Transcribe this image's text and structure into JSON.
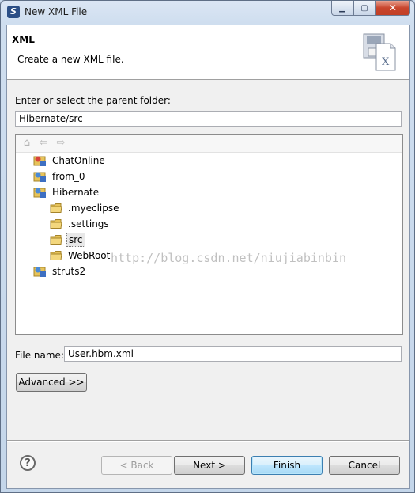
{
  "window": {
    "title": "New XML File",
    "minimize_glyph": "▁",
    "maximize_glyph": "▢",
    "close_glyph": "✕"
  },
  "banner": {
    "title": "XML",
    "description": "Create a new XML file.",
    "image_icon": "xml-file-wizard-icon"
  },
  "parent_folder": {
    "label": "Enter or select the parent folder:",
    "value": "Hibernate/src"
  },
  "tree": {
    "nav": {
      "home_icon": "⌂",
      "back_icon": "⇦",
      "forward_icon": "⇨"
    },
    "items": [
      {
        "label": "ChatOnline",
        "type": "project",
        "depth": 0
      },
      {
        "label": "from_0",
        "type": "project",
        "depth": 0
      },
      {
        "label": "Hibernate",
        "type": "project",
        "depth": 0
      },
      {
        "label": ".myeclipse",
        "type": "folder",
        "depth": 1
      },
      {
        "label": ".settings",
        "type": "folder",
        "depth": 1
      },
      {
        "label": "src",
        "type": "folder",
        "depth": 1,
        "selected": true
      },
      {
        "label": "WebRoot",
        "type": "folder",
        "depth": 1
      },
      {
        "label": "struts2",
        "type": "project",
        "depth": 0
      }
    ]
  },
  "watermark": "http://blog.csdn.net/niujiabinbin",
  "file_name": {
    "label": "File name:",
    "value": "User.hbm.xml"
  },
  "buttons": {
    "advanced": "Advanced >>",
    "help": "?",
    "back": "< Back",
    "next": "Next >",
    "finish": "Finish",
    "cancel": "Cancel"
  },
  "colors": {
    "folder": "#e7c35a",
    "project_blue": "#3d6fc2",
    "project_red": "#d8433a",
    "finish_border": "#3c7fb1"
  }
}
